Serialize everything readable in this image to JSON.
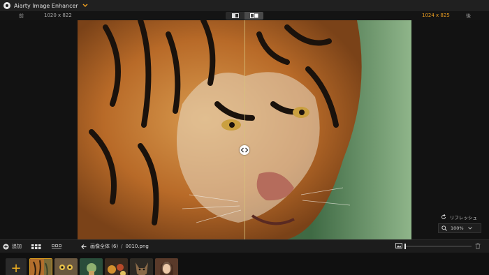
{
  "app": {
    "title": "Aiarty Image Enhancer"
  },
  "info": {
    "before_label": "前",
    "left_size": "1020 x 822",
    "right_size": "1024 x 825",
    "after_label": "後"
  },
  "side_panel": {
    "refresh_label": "リフレッシュ",
    "zoom_value": "100%"
  },
  "toolbar": {
    "add_label": "追加",
    "breadcrumb_all": "画像全体 (6)",
    "breadcrumb_sep": "/",
    "breadcrumb_file": "0010.png"
  },
  "filmstrip": {
    "add_symbol": "+",
    "thumbs": [
      "tiger",
      "owl",
      "forest-figure",
      "food",
      "dog",
      "portrait"
    ]
  },
  "colors": {
    "accent": "#f0a020",
    "background": "#161616"
  }
}
